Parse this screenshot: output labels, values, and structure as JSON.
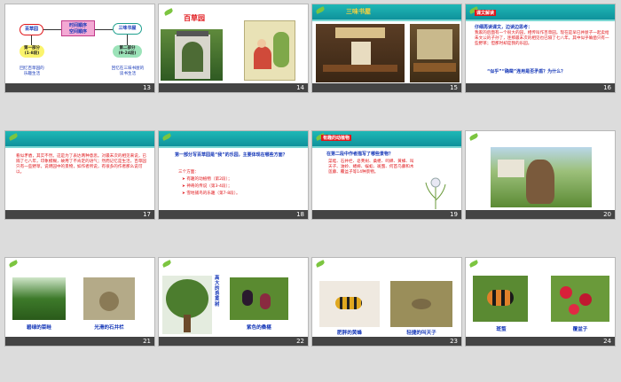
{
  "slides": [
    {
      "number": "13",
      "center": "时间顺序\n空间顺序",
      "left_node": "百草园",
      "right_node": "三味书屋",
      "left_sub": "第一部分\n(1-8段)",
      "right_sub": "第二部分\n(9-24段)",
      "left_bottom": "回忆百草园的\n乐趣生活",
      "right_bottom": "回忆在三味书屋的\n读书生活"
    },
    {
      "number": "14",
      "title": "百草园"
    },
    {
      "number": "15",
      "title": "三味书屋"
    },
    {
      "number": "16",
      "badge": "课文解读",
      "question": "仔细再读课文，边读边思考：",
      "body": "我家的后面有一个很大的园，相传叫作百草园。现在是早已并屋子一起卖给朱文公的子孙了，连那最末次的相见也已隔了七八年，其中似乎确凿只有一些野草；但那时却是我的乐园。",
      "q2": "“似乎”“确凿”连用是否矛盾？为什么？"
    },
    {
      "number": "17",
      "body": "看似矛盾，其实不然。这是为了表达两种意思。对最末次的相见来说，已隔了七八年，印象模糊，故用了不肯定的语气；然而记忆是生活，百草园只有一些野草，说明园中的景物，如作者所说，有很多的作者那么说可以。"
    },
    {
      "number": "18",
      "q": "第一部分写百草园是“我”的乐园，主要体现在哪些方面？",
      "head": "三个方面：",
      "items": [
        "有趣的动植物（第2段）；",
        "神奇的传说（第3-4段）；",
        "雪地捕鸟的乐趣（第7-8段）。"
      ]
    },
    {
      "number": "19",
      "badge": "有趣的动植物",
      "q": "在第二段中作者描写了哪些景物？",
      "body": "菜畦、石井栏、皂荚树、桑椹、鸣蝉、黄蜂、叫天子、油蛉、蟋蟀、蜈蚣、斑蝥、何首乌藤和木莲藤、覆盆子等14种景物。"
    },
    {
      "number": "20"
    },
    {
      "number": "21",
      "caps": [
        "碧绿的菜畦",
        "光滑的石井栏"
      ]
    },
    {
      "number": "22",
      "caps": [
        "高大的皂荚树",
        "紫色的桑椹"
      ]
    },
    {
      "number": "23",
      "caps": [
        "肥胖的黄蜂",
        "轻捷的叫天子"
      ]
    },
    {
      "number": "24",
      "caps": [
        "斑蝥",
        "覆盆子"
      ]
    }
  ]
}
